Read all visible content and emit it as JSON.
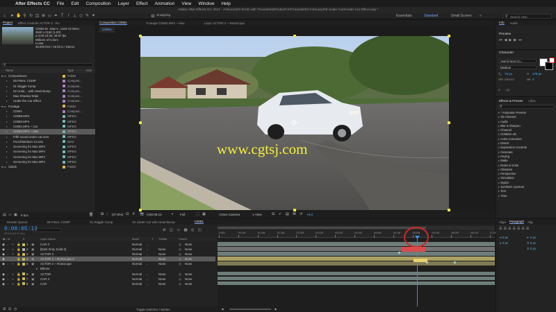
{
  "menubar": {
    "app": "After Effects CC",
    "items": [
      "File",
      "Edit",
      "Composition",
      "Layer",
      "Effect",
      "Animation",
      "View",
      "Window",
      "Help"
    ]
  },
  "titlebar": "Adobe After Effects CC 2017 - /Volumes/G-RAID with Thunderbolt/VideoFort/Tutorials/02 February/08 Under Car/Under Car Effect.aep *",
  "toolbar": {
    "snapping": "Snapping",
    "workspaces": [
      "Essentials",
      "Standard",
      "Small Screen"
    ],
    "active_workspace": "Standard",
    "search_help": "Search Help"
  },
  "project": {
    "tabs": [
      "Project",
      "Effect Controls ACTOR 2 - Ro"
    ],
    "thumb_name": "C0092.M..  Max ▾ , used 13 times",
    "thumb_info": [
      "3840 x 2160 (1.00)",
      "Δ 0;00:13:30, 29.97 fps",
      "Millions of Colors",
      "H.264",
      "48.000 kHz / 16 bit U / Stereo"
    ],
    "search_placeholder": "",
    "col_name": "Name",
    "col_type": "Type",
    "col_size": "Size",
    "items": [
      {
        "name": "Compositions",
        "type": "Folder",
        "color": "#d9b84a",
        "indent": 0,
        "folder": true
      },
      {
        "name": "00 FINAL COMP",
        "type": "Composi...",
        "color": "#a97fc4",
        "indent": 1
      },
      {
        "name": "01 Wiggle Comp",
        "type": "Composi...",
        "color": "#a97fc4",
        "indent": 1
      },
      {
        "name": "02 Unde... with Head Bump",
        "type": "Composi...",
        "color": "#a97fc4",
        "indent": 1
      },
      {
        "name": "Max Shadow Wipe",
        "type": "Composi...",
        "color": "#a97fc4",
        "indent": 1
      },
      {
        "name": "Under the Car Effect",
        "type": "Composi...",
        "color": "#a97fc4",
        "indent": 1
      },
      {
        "name": "Footage",
        "type": "Folder",
        "color": "#d9b84a",
        "indent": 0,
        "folder": true
      },
      {
        "name": "C0091",
        "type": "Composi...",
        "color": "#a97fc4",
        "indent": 1
      },
      {
        "name": "C0088.MP4",
        "type": "MPEG",
        "color": "#6fb8b8",
        "indent": 1
      },
      {
        "name": "C0089.MP4",
        "type": "MPEG",
        "color": "#6fb8b8",
        "indent": 1
      },
      {
        "name": "C0091.MP4 ~ Car",
        "type": "MPEG",
        "color": "#6fb8b8",
        "indent": 1
      },
      {
        "name": "C0092.MP4 ~ Max",
        "type": "MPEG",
        "color": "#6fb8b8",
        "indent": 1,
        "selected": true
      },
      {
        "name": "Fifth sound under car.m4a",
        "type": "MPEG",
        "color": "#6fb8b8",
        "indent": 1
      },
      {
        "name": "PunchMedium 13.wav",
        "type": "WAV",
        "color": "#6fb8b8",
        "indent": 1
      },
      {
        "name": "Screening for Max.MP4",
        "type": "MPEG",
        "color": "#6fb8b8",
        "indent": 1
      },
      {
        "name": "Screening for Max.MP4",
        "type": "MPEG",
        "color": "#6fb8b8",
        "indent": 1
      },
      {
        "name": "Screening for Max.MP4",
        "type": "MPEG",
        "color": "#6fb8b8",
        "indent": 1
      },
      {
        "name": "Screening for Max.MP4",
        "type": "MPEG",
        "color": "#6fb8b8",
        "indent": 1
      },
      {
        "name": "Solids",
        "type": "Folder",
        "color": "#d9b84a",
        "indent": 0,
        "folder": true
      }
    ],
    "footer": "8 bpc"
  },
  "viewer": {
    "tabs": [
      "Composition C0091",
      "Footage C0092.MP4 ~ Max",
      "Layer ACTOR 2 ~ Rotoscope"
    ],
    "sub_tab": "C0091",
    "watermark": "www.cgtsj.com",
    "footer": {
      "zoom": "(27.8%)",
      "timecode": "0;00:05:13",
      "resolution": "Full",
      "camera": "Active Camera",
      "views": "1 View",
      "exposure": "+0.0"
    }
  },
  "right": {
    "info_tabs": [
      "Info",
      "Audio"
    ],
    "preview_title": "Preview",
    "character_title": "Character",
    "font_family": "Avenir Next Co...",
    "font_style": "Medium",
    "font_size": "75 px",
    "leading": "178 px",
    "kerning": "Metrics",
    "tracking": "0",
    "px_unit": "- px",
    "effects_title": "Effects & Presets",
    "libraries_tab": "Libra",
    "effects": [
      "* Animation Presets",
      "3D Channel",
      "Audio",
      "Blur & Sharpen",
      "Channel",
      "CINEMA 4D",
      "Color Correction",
      "Distort",
      "Expression Controls",
      "Generate",
      "Keying",
      "Matte",
      "Noise & Grain",
      "Obsolete",
      "Perspective",
      "Simulation",
      "Stylize",
      "Synthetic Aperture",
      "Text",
      "Time"
    ]
  },
  "timeline": {
    "tabs": [
      "Render Queue",
      "00 FINAL COMP",
      "01 Wiggle Comp",
      "02 Under Car with Head Bump",
      "C0091"
    ],
    "timecode": "0:00:05:13",
    "frame_info": "00163 (29.97 fps)",
    "col_layer_name": "Layer Name",
    "col_mode": "Mode",
    "col_t": "T",
    "col_trkmat": "TrkMat",
    "col_parent": "Parent",
    "layers": [
      {
        "num": "1",
        "name": "CAR 2",
        "mode": "Normal",
        "trkmat": "",
        "parent": "None",
        "color": "#c9b85a"
      },
      {
        "num": "2",
        "name": "[Dark Gray Solid 2]",
        "mode": "Normal",
        "trkmat": "None",
        "parent": "None",
        "color": "#b0b0b0"
      },
      {
        "num": "3",
        "name": "ACTOR 3",
        "mode": "Normal",
        "trkmat": "None",
        "parent": "None",
        "color": "#c9b85a"
      },
      {
        "num": "4",
        "name": "ACTOR 2 ~ Rotoscope 2",
        "mode": "Normal",
        "trkmat": "None",
        "parent": "None",
        "color": "#c9b85a",
        "selected": true
      },
      {
        "num": "5",
        "name": "ACTOR 2 ~ Rotoscope",
        "mode": "Normal",
        "trkmat": "None",
        "parent": "None",
        "color": "#c9b85a"
      },
      {
        "num": "",
        "name": "Effects",
        "mode": "",
        "trkmat": "",
        "parent": "",
        "color": "",
        "sub": true
      },
      {
        "num": "6",
        "name": "ACTOR",
        "mode": "Normal",
        "trkmat": "None",
        "parent": "None",
        "color": "#c9b85a"
      },
      {
        "num": "7",
        "name": "CAR 3",
        "mode": "Normal",
        "trkmat": "None",
        "parent": "None",
        "color": "#c9b85a"
      },
      {
        "num": "8",
        "name": "CAR",
        "mode": "Normal",
        "trkmat": "None",
        "parent": "None",
        "color": "#c9b85a"
      }
    ],
    "ruler": [
      "0:00f",
      "00:15f",
      "01:00f",
      "01:15f",
      "02:00f",
      "02:15f",
      "03:00f",
      "03:15f",
      "04:00f",
      "04:15f",
      "05:00f",
      "05:15f",
      "06:00f",
      "06:15f",
      "07:00f"
    ],
    "footer": "Toggle Switches / Modes"
  },
  "paragraph": {
    "tabs": [
      "Align",
      "Paragraph",
      "Alig"
    ],
    "active": "Paragraph",
    "values": [
      "0 px",
      "0 px",
      "0 px",
      "0 px",
      "0 px"
    ]
  },
  "colors": {
    "accent": "#3bb7ff",
    "playhead": "#3f8cff",
    "annotation": "#d22828"
  }
}
